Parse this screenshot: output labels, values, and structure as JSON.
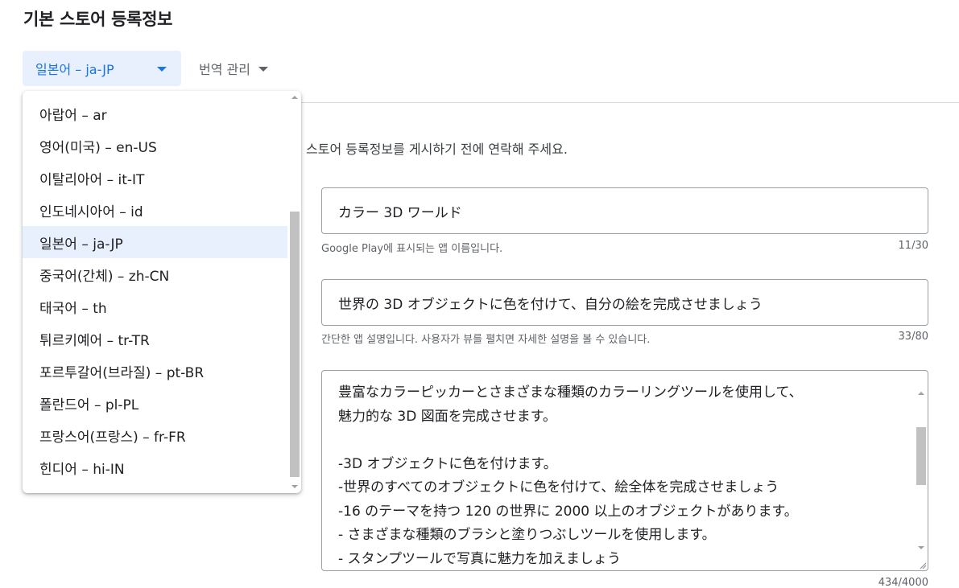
{
  "page": {
    "title": "기본 스토어 등록정보"
  },
  "language_select": {
    "selected": "일본어 – ja-JP"
  },
  "translation_menu": {
    "label": "번역 관리"
  },
  "notice": "스토어 등록정보를 게시하기 전에 연락해 주세요.",
  "app_name": {
    "value": "カラー 3D ワールド",
    "hint": "Google Play에 표시되는 앱 이름입니다.",
    "counter": "11/30"
  },
  "short_description": {
    "value": "世界の 3D オブジェクトに色を付けて、自分の絵を完成させましょう",
    "hint": "간단한 앱 설명입니다. 사용자가 뷰를 펼치면 자세한 설명을 볼 수 있습니다.",
    "counter": "33/80"
  },
  "full_description": {
    "value": "豊富なカラーピッカーとさまざまな種類のカラーリングツールを使用して、\n魅力的な 3D 図面を完成させます。\n\n-3D オブジェクトに色を付けます。\n-世界のすべてのオブジェクトに色を付けて、絵全体を完成させましょう\n-16 のテーマを持つ 120 の世界に 2000 以上のオブジェクトがあります。\n- さまざまな種類のブラシと塗りつぶしツールを使用します。\n- スタンプツールで写真に魅力を加えましょう",
    "counter": "434/4000"
  },
  "language_dropdown": {
    "items": [
      {
        "label": "아랍어 – ar"
      },
      {
        "label": "영어(미국) – en-US"
      },
      {
        "label": "이탈리아어 – it-IT"
      },
      {
        "label": "인도네시아어 – id"
      },
      {
        "label": "일본어 – ja-JP"
      },
      {
        "label": "중국어(간체) – zh-CN"
      },
      {
        "label": "태국어 – th"
      },
      {
        "label": "튀르키예어 – tr-TR"
      },
      {
        "label": "포르투갈어(브라질) – pt-BR"
      },
      {
        "label": "폴란드어 – pl-PL"
      },
      {
        "label": "프랑스어(프랑스) – fr-FR"
      },
      {
        "label": "힌디어 – hi-IN"
      }
    ],
    "selected_index": 4
  },
  "colors": {
    "accent": "#1a73e8",
    "selected_bg": "#e8f0fe",
    "border": "#9aa0a6",
    "hint": "#5f6368"
  }
}
